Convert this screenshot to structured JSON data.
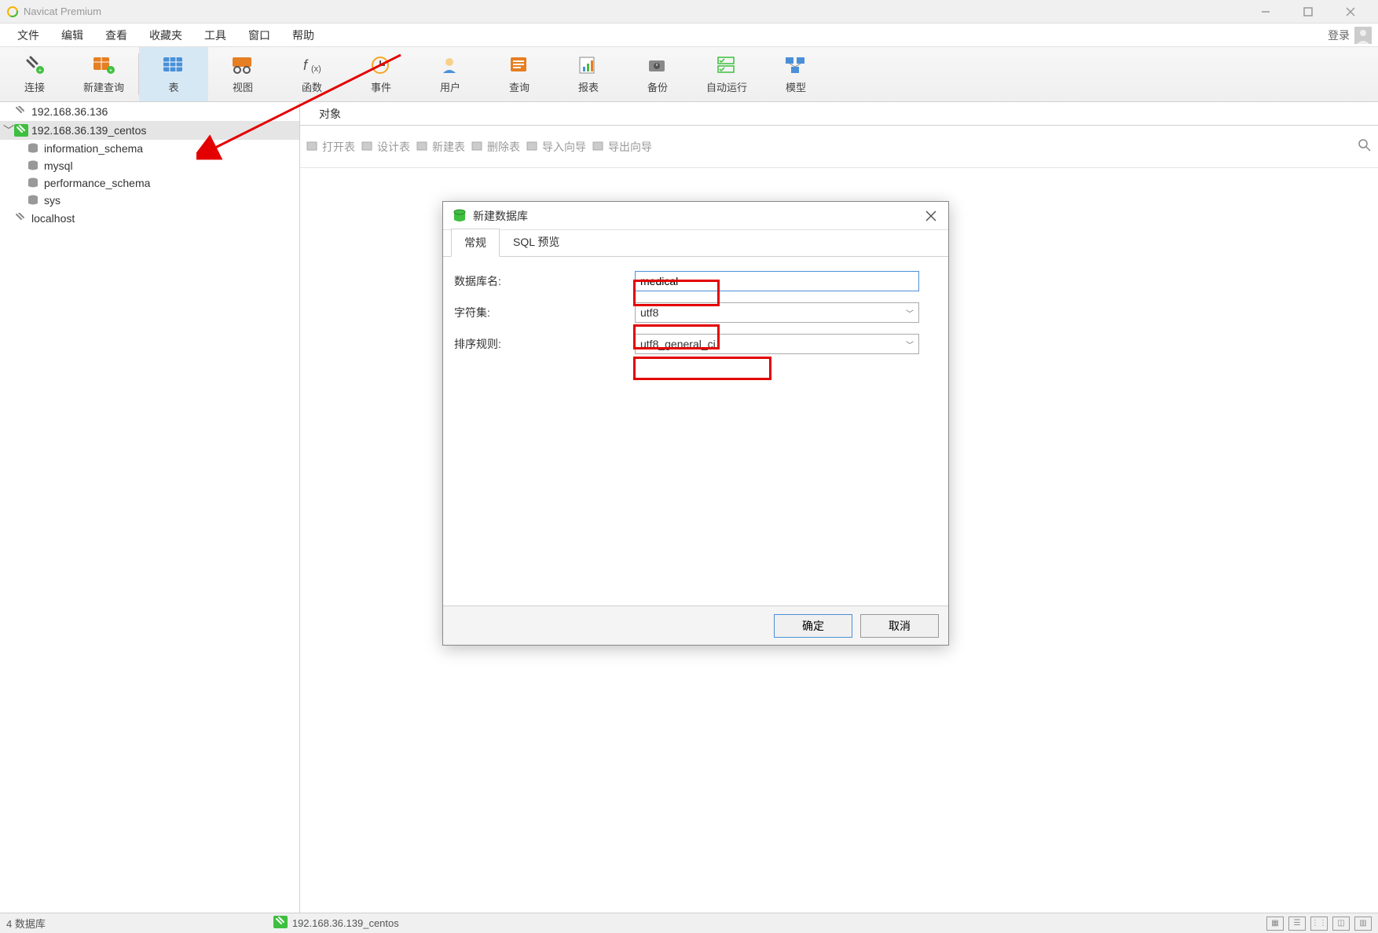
{
  "app": {
    "title": "Navicat Premium"
  },
  "menubar": {
    "items": [
      "文件",
      "编辑",
      "查看",
      "收藏夹",
      "工具",
      "窗口",
      "帮助"
    ],
    "login": "登录"
  },
  "toolbar": {
    "items": [
      {
        "label": "连接"
      },
      {
        "label": "新建查询"
      },
      {
        "label": "表",
        "active": true
      },
      {
        "label": "视图"
      },
      {
        "label": "函数"
      },
      {
        "label": "事件"
      },
      {
        "label": "用户"
      },
      {
        "label": "查询"
      },
      {
        "label": "报表"
      },
      {
        "label": "备份"
      },
      {
        "label": "自动运行"
      },
      {
        "label": "模型"
      }
    ]
  },
  "sidebar": {
    "conn1": "192.168.36.136",
    "conn2": "192.168.36.139_centos",
    "dbs": [
      "information_schema",
      "mysql",
      "performance_schema",
      "sys"
    ],
    "conn3": "localhost"
  },
  "main": {
    "tab": "对象",
    "toolbar": [
      "打开表",
      "设计表",
      "新建表",
      "删除表",
      "导入向导",
      "导出向导"
    ]
  },
  "dialog": {
    "title": "新建数据库",
    "tabs": [
      "常规",
      "SQL 预览"
    ],
    "labels": {
      "name": "数据库名:",
      "charset": "字符集:",
      "collation": "排序规则:"
    },
    "values": {
      "name": "medical",
      "charset": "utf8",
      "collation": "utf8_general_ci"
    },
    "buttons": {
      "ok": "确定",
      "cancel": "取消"
    }
  },
  "status": {
    "left": "4 数据库",
    "conn": "192.168.36.139_centos"
  }
}
